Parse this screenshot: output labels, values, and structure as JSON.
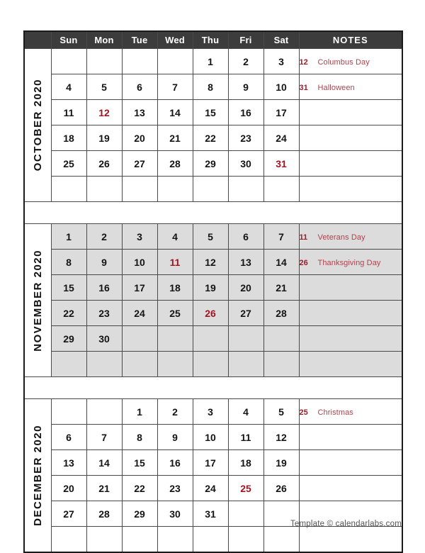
{
  "footer": {
    "text": "Template © calendarlabs.com"
  },
  "header": {
    "month_col_label": "",
    "weekdays": [
      "Sun",
      "Mon",
      "Tue",
      "Wed",
      "Thu",
      "Fri",
      "Sat"
    ],
    "notes_label": "NOTES"
  },
  "colors": {
    "header_bg": "#3c3c3c",
    "header_text": "#ffffff",
    "holiday_red": "#A01522",
    "note_day_red": "#9E1B28",
    "note_text_red": "#B0414C",
    "shaded_row_bg": "#dcdcdc",
    "grid_border": "#4a4a4a",
    "footer_text": "#555555"
  },
  "months": [
    {
      "label": "OCTOBER 2020",
      "shaded": false,
      "weeks": [
        [
          "",
          "",
          "",
          "",
          "1",
          "2",
          "3"
        ],
        [
          "4",
          "5",
          "6",
          "7",
          "8",
          "9",
          "10"
        ],
        [
          "11",
          "12",
          "13",
          "14",
          "15",
          "16",
          "17"
        ],
        [
          "18",
          "19",
          "20",
          "21",
          "22",
          "23",
          "24"
        ],
        [
          "25",
          "26",
          "27",
          "28",
          "29",
          "30",
          "31"
        ],
        [
          "",
          "",
          "",
          "",
          "",
          "",
          ""
        ]
      ],
      "holidays_in_grid": [
        "12",
        "31"
      ],
      "notes": [
        {
          "day": "12",
          "text": "Columbus Day"
        },
        {
          "day": "31",
          "text": "Halloween"
        },
        {
          "day": "",
          "text": ""
        },
        {
          "day": "",
          "text": ""
        },
        {
          "day": "",
          "text": ""
        },
        {
          "day": "",
          "text": ""
        }
      ]
    },
    {
      "label": "NOVEMBER 2020",
      "shaded": true,
      "weeks": [
        [
          "1",
          "2",
          "3",
          "4",
          "5",
          "6",
          "7"
        ],
        [
          "8",
          "9",
          "10",
          "11",
          "12",
          "13",
          "14"
        ],
        [
          "15",
          "16",
          "17",
          "18",
          "19",
          "20",
          "21"
        ],
        [
          "22",
          "23",
          "24",
          "25",
          "26",
          "27",
          "28"
        ],
        [
          "29",
          "30",
          "",
          "",
          "",
          "",
          ""
        ],
        [
          "",
          "",
          "",
          "",
          "",
          "",
          ""
        ]
      ],
      "holidays_in_grid": [
        "11",
        "26"
      ],
      "notes": [
        {
          "day": "11",
          "text": "Veterans Day"
        },
        {
          "day": "26",
          "text": "Thanksgiving Day"
        },
        {
          "day": "",
          "text": ""
        },
        {
          "day": "",
          "text": ""
        },
        {
          "day": "",
          "text": ""
        },
        {
          "day": "",
          "text": ""
        }
      ]
    },
    {
      "label": "DECEMBER 2020",
      "shaded": false,
      "weeks": [
        [
          "",
          "",
          "1",
          "2",
          "3",
          "4",
          "5"
        ],
        [
          "6",
          "7",
          "8",
          "9",
          "10",
          "11",
          "12"
        ],
        [
          "13",
          "14",
          "15",
          "16",
          "17",
          "18",
          "19"
        ],
        [
          "20",
          "21",
          "22",
          "23",
          "24",
          "25",
          "26"
        ],
        [
          "27",
          "28",
          "29",
          "30",
          "31",
          "",
          ""
        ],
        [
          "",
          "",
          "",
          "",
          "",
          "",
          ""
        ]
      ],
      "holidays_in_grid": [
        "25"
      ],
      "notes": [
        {
          "day": "25",
          "text": "Christmas"
        },
        {
          "day": "",
          "text": ""
        },
        {
          "day": "",
          "text": ""
        },
        {
          "day": "",
          "text": ""
        },
        {
          "day": "",
          "text": ""
        },
        {
          "day": "",
          "text": ""
        }
      ]
    }
  ]
}
